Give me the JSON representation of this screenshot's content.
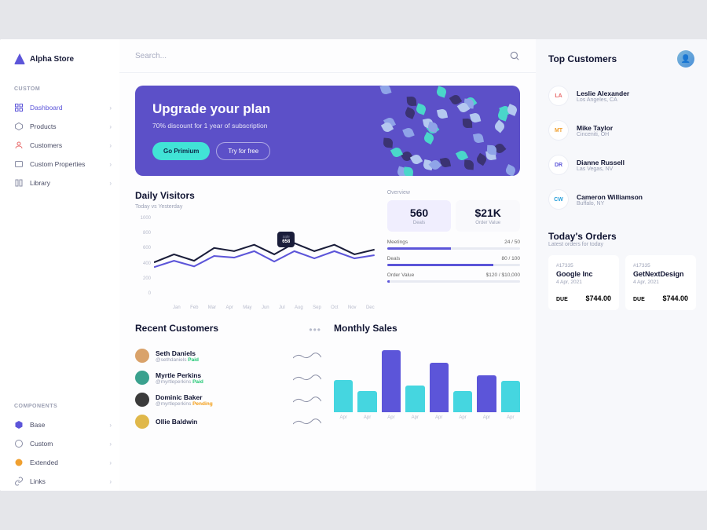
{
  "brand": {
    "name": "Alpha Store"
  },
  "sidebar": {
    "section1_label": "CUSTOM",
    "section2_label": "COMPONENTS",
    "custom": [
      {
        "label": "Dashboard"
      },
      {
        "label": "Products"
      },
      {
        "label": "Customers"
      },
      {
        "label": "Custom Properties"
      },
      {
        "label": "Library"
      }
    ],
    "components": [
      {
        "label": "Base"
      },
      {
        "label": "Custom"
      },
      {
        "label": "Extended"
      },
      {
        "label": "Links"
      }
    ]
  },
  "search": {
    "placeholder": "Search..."
  },
  "banner": {
    "title": "Upgrade your plan",
    "subtitle": "70% discount for 1 year of subscription",
    "primary": "Go Primium",
    "secondary": "Try for free"
  },
  "visitors": {
    "title": "Daily Visitors",
    "subtitle": "Today vs Yesterday",
    "tooltip_label": "sale",
    "tooltip_value": "658"
  },
  "overview": {
    "title": "Overview",
    "deals_value": "560",
    "deals_label": "Deals",
    "ordervalue_value": "$21K",
    "ordervalue_label": "Order Value",
    "bars": [
      {
        "label": "Meetings",
        "text": "24 / 50",
        "pct": 48
      },
      {
        "label": "Deals",
        "text": "80 / 100",
        "pct": 80
      },
      {
        "label": "Order Value",
        "text": "$120 / $10,000",
        "pct": 2
      }
    ]
  },
  "chart_data": [
    {
      "type": "line",
      "title": "Daily Visitors",
      "subtitle": "Today vs Yesterday",
      "ylim": [
        0,
        1000
      ],
      "yticks": [
        0,
        200,
        400,
        600,
        800,
        1000
      ],
      "categories": [
        "Jan",
        "Feb",
        "Mar",
        "Apr",
        "May",
        "Jun",
        "Jul",
        "Aug",
        "Sep",
        "Oct",
        "Nov",
        "Dec"
      ],
      "series": [
        {
          "name": "Today",
          "color": "#1a1d3a",
          "values": [
            420,
            520,
            440,
            600,
            560,
            640,
            520,
            660,
            560,
            640,
            520,
            580
          ]
        },
        {
          "name": "Yesterday",
          "color": "#5c55d9",
          "values": [
            360,
            440,
            370,
            500,
            480,
            560,
            430,
            560,
            470,
            560,
            470,
            510
          ]
        }
      ]
    },
    {
      "type": "bar",
      "title": "Monthly Sales",
      "categories": [
        "Apr",
        "Apr",
        "Apr",
        "Apr",
        "Apr",
        "Apr",
        "Apr",
        "Apr"
      ],
      "values": [
        46,
        30,
        88,
        38,
        70,
        30,
        52,
        44
      ],
      "colors": [
        "#45d6e0",
        "#45d6e0",
        "#5c55d9",
        "#45d6e0",
        "#5c55d9",
        "#45d6e0",
        "#5c55d9",
        "#45d6e0"
      ]
    }
  ],
  "recent": {
    "title": "Recent Customers",
    "items": [
      {
        "name": "Seth Daniels",
        "handle": "@sethdaniels",
        "status": "Paid",
        "status_class": "paid",
        "color": "#d9a26a"
      },
      {
        "name": "Myrtle Perkins",
        "handle": "@myrtleperkins",
        "status": "Paid",
        "status_class": "paid",
        "color": "#3aa18e"
      },
      {
        "name": "Dominic Baker",
        "handle": "@myrtleperkins",
        "status": "Pending",
        "status_class": "pending",
        "color": "#3b3b3b"
      },
      {
        "name": "Ollie Baldwin",
        "handle": "",
        "status": "",
        "status_class": "",
        "color": "#e0b84a"
      }
    ]
  },
  "monthly": {
    "title": "Monthly Sales"
  },
  "right": {
    "top_title": "Top Customers",
    "customers": [
      {
        "initials": "LA",
        "cls": "la",
        "name": "Leslie Alexander",
        "loc": "Los Angeles, CA"
      },
      {
        "initials": "MT",
        "cls": "mt",
        "name": "Mike Taylor",
        "loc": "Cinceniti, OH"
      },
      {
        "initials": "DR",
        "cls": "dr",
        "name": "Dianne Russell",
        "loc": "Las Vegas, NV"
      },
      {
        "initials": "CW",
        "cls": "cw",
        "name": "Cameron Williamson",
        "loc": "Buffalo, NY"
      }
    ],
    "orders_title": "Today's Orders",
    "orders_sub": "Latest orders for today",
    "orders": [
      {
        "id": "#17335",
        "name": "Google Inc",
        "date": "4 Apr, 2021",
        "due": "DUE",
        "amount": "$744.00"
      },
      {
        "id": "#17335",
        "name": "GetNextDesign",
        "date": "4 Apr, 2021",
        "due": "DUE",
        "amount": "$744.00"
      }
    ]
  }
}
